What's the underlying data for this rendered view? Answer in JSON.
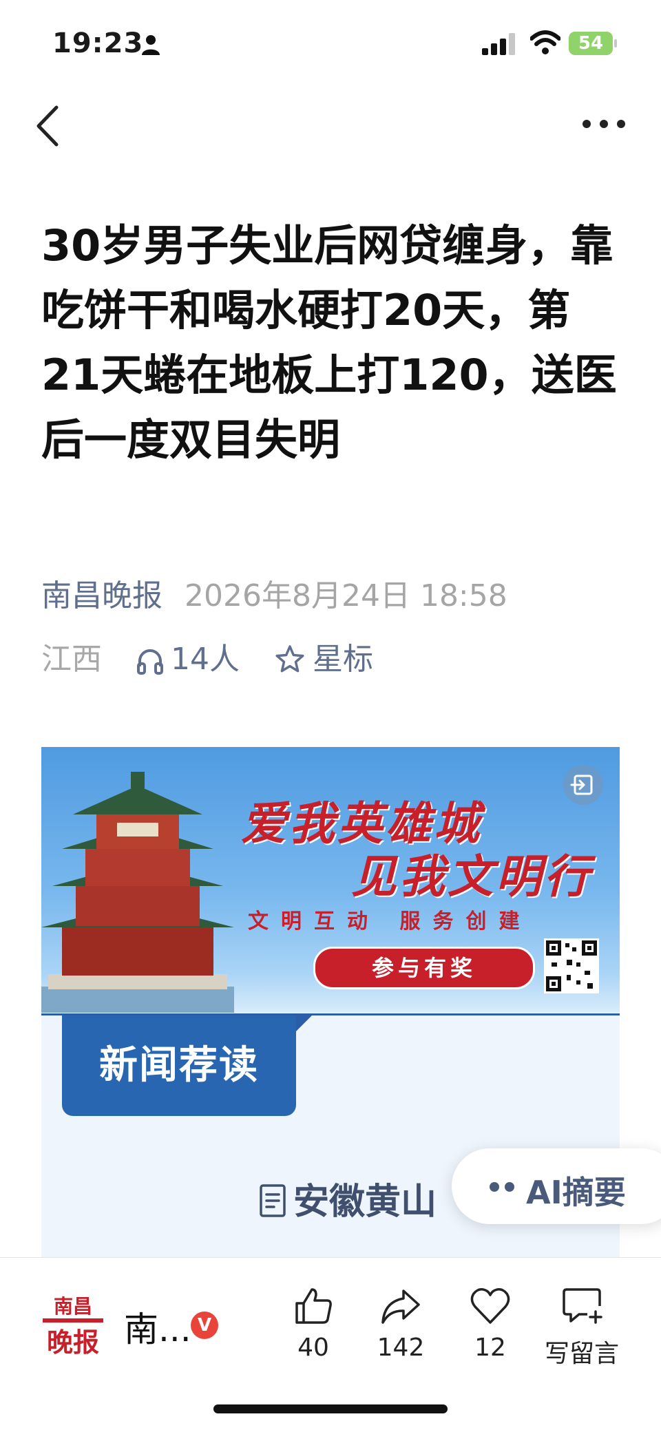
{
  "status_bar": {
    "time": "19:23",
    "battery": "54"
  },
  "article": {
    "title": "30岁男子失业后网贷缠身，靠吃饼干和喝水硬打20天，第21天蜷在地板上打120，送医后一度双目失明",
    "source": "南昌晚报",
    "publish_time": "2026年8月24日 18:58",
    "region": "江西",
    "listeners": "14人",
    "star_label": "星标"
  },
  "banner": {
    "slogan_line1": "爱我英雄城",
    "slogan_line2": "见我文明行",
    "subtitle": "文明互动 服务创建",
    "button_label": "参与有奖"
  },
  "news_section": {
    "tab_label": "新闻荐读",
    "item_title": "安徽黄山"
  },
  "ai_summary": {
    "label": "AI摘要"
  },
  "bottom_bar": {
    "account_name": "南...",
    "verified_mark": "V",
    "logo_line1": "南昌",
    "logo_line2": "晚报",
    "likes": "40",
    "shares": "142",
    "favorites": "12",
    "comment_label": "写留言"
  },
  "colors": {
    "accent_blue": "#2866b1",
    "meta_blue_gray": "#5f6f8d",
    "banner_red": "#c8202a",
    "battery_green": "#8fd36a",
    "verified_red": "#e9443a"
  }
}
